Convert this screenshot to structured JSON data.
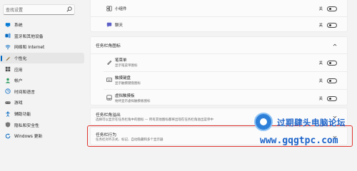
{
  "sidebar": {
    "search_placeholder": "查找设置",
    "items": [
      {
        "label": "系统",
        "icon": "monitor-icon",
        "color": "#0078d4"
      },
      {
        "label": "蓝牙和其他设备",
        "icon": "bluetooth-icon",
        "color": "#0067c0"
      },
      {
        "label": "网络和 Internet",
        "icon": "wifi-icon",
        "color": "#0067c0"
      },
      {
        "label": "个性化",
        "icon": "pen-icon",
        "color": "#8a6d3b",
        "active": true
      },
      {
        "label": "应用",
        "icon": "apps-icon",
        "color": "#4a4a4a"
      },
      {
        "label": "帐户",
        "icon": "person-icon",
        "color": "#2e9d5f"
      },
      {
        "label": "时间和语言",
        "icon": "globe-clock-icon",
        "color": "#0067c0"
      },
      {
        "label": "游戏",
        "icon": "gamepad-icon",
        "color": "#555555"
      },
      {
        "label": "辅助功能",
        "icon": "accessibility-icon",
        "color": "#0067c0"
      },
      {
        "label": "隐私和安全性",
        "icon": "shield-icon",
        "color": "#777777"
      },
      {
        "label": "Windows 更新",
        "icon": "update-icon",
        "color": "#0067c0"
      }
    ]
  },
  "main": {
    "top_items": [
      {
        "label": "小组件",
        "icon": "widgets-icon",
        "state": "关"
      },
      {
        "label": "聊天",
        "icon": "chat-icon",
        "state": "关"
      }
    ],
    "corner_icons_section": {
      "title": "任务栏角图标",
      "items": [
        {
          "label": "笔菜单",
          "desc": "显示笔菜单图标",
          "icon": "pen-menu-icon",
          "state": "关"
        },
        {
          "label": "触摸键盘",
          "desc": "显示触摸键盘图标",
          "icon": "keyboard-icon",
          "state": "关"
        },
        {
          "label": "虚拟触摸板",
          "desc": "始终显示虚拟触摸板图标",
          "icon": "touchpad-icon",
          "state": "关"
        }
      ]
    },
    "overflow_section": {
      "title": "任务栏角溢出",
      "desc": "选择可以显示在任务栏角中的图标 — 所有其他图标都将出现在任务栏角溢出菜单中"
    },
    "behavior_section": {
      "title": "任务栏行为",
      "desc": "任务栏对齐方式、标记、自动隐藏和多个显示器"
    }
  },
  "watermark": {
    "title": "过期肆头电脑论坛",
    "url": "www.gqgtpc.com"
  },
  "colors": {
    "accent": "#0067c0",
    "highlight_border": "#e0342f",
    "watermark_blue": "#1d64c9"
  }
}
